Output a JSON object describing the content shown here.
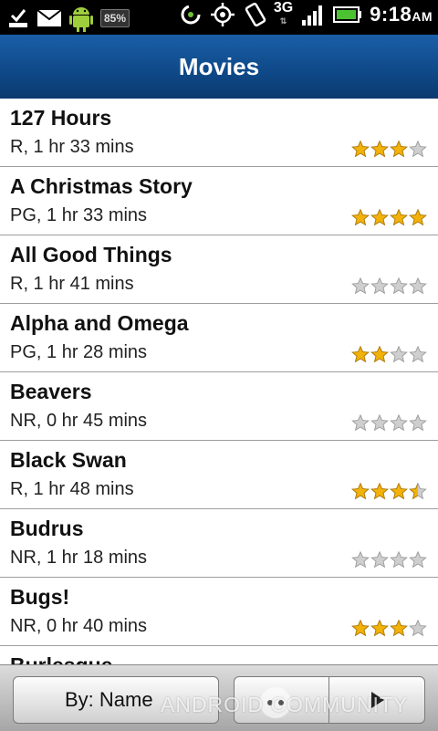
{
  "status_bar": {
    "battery_badge": "85%",
    "network": "3G",
    "time": "9:18",
    "ampm": "AM"
  },
  "header": {
    "title": "Movies"
  },
  "movies": [
    {
      "title": "127 Hours",
      "details": "R, 1 hr 33 mins",
      "rating": 3
    },
    {
      "title": "A Christmas Story",
      "details": "PG, 1 hr 33 mins",
      "rating": 4
    },
    {
      "title": "All Good Things",
      "details": "R, 1 hr 41 mins",
      "rating": 0
    },
    {
      "title": "Alpha and Omega",
      "details": "PG, 1 hr 28 mins",
      "rating": 2
    },
    {
      "title": "Beavers",
      "details": "NR, 0 hr 45 mins",
      "rating": 0
    },
    {
      "title": "Black Swan",
      "details": "R, 1 hr 48 mins",
      "rating": 3.5
    },
    {
      "title": "Budrus",
      "details": "NR, 1 hr 18 mins",
      "rating": 0
    },
    {
      "title": "Bugs!",
      "details": "NR, 0 hr 40 mins",
      "rating": 3
    },
    {
      "title": "Burlesque",
      "details": "",
      "rating": null
    }
  ],
  "rating_max": 4,
  "colors": {
    "star_filled": "#f2b20a",
    "star_empty": "#cfcfcf",
    "header_blue": "#0f4a8a"
  },
  "bottom_bar": {
    "sort_label": "By:  Name"
  },
  "watermark": "ANDROID COMMUNITY"
}
